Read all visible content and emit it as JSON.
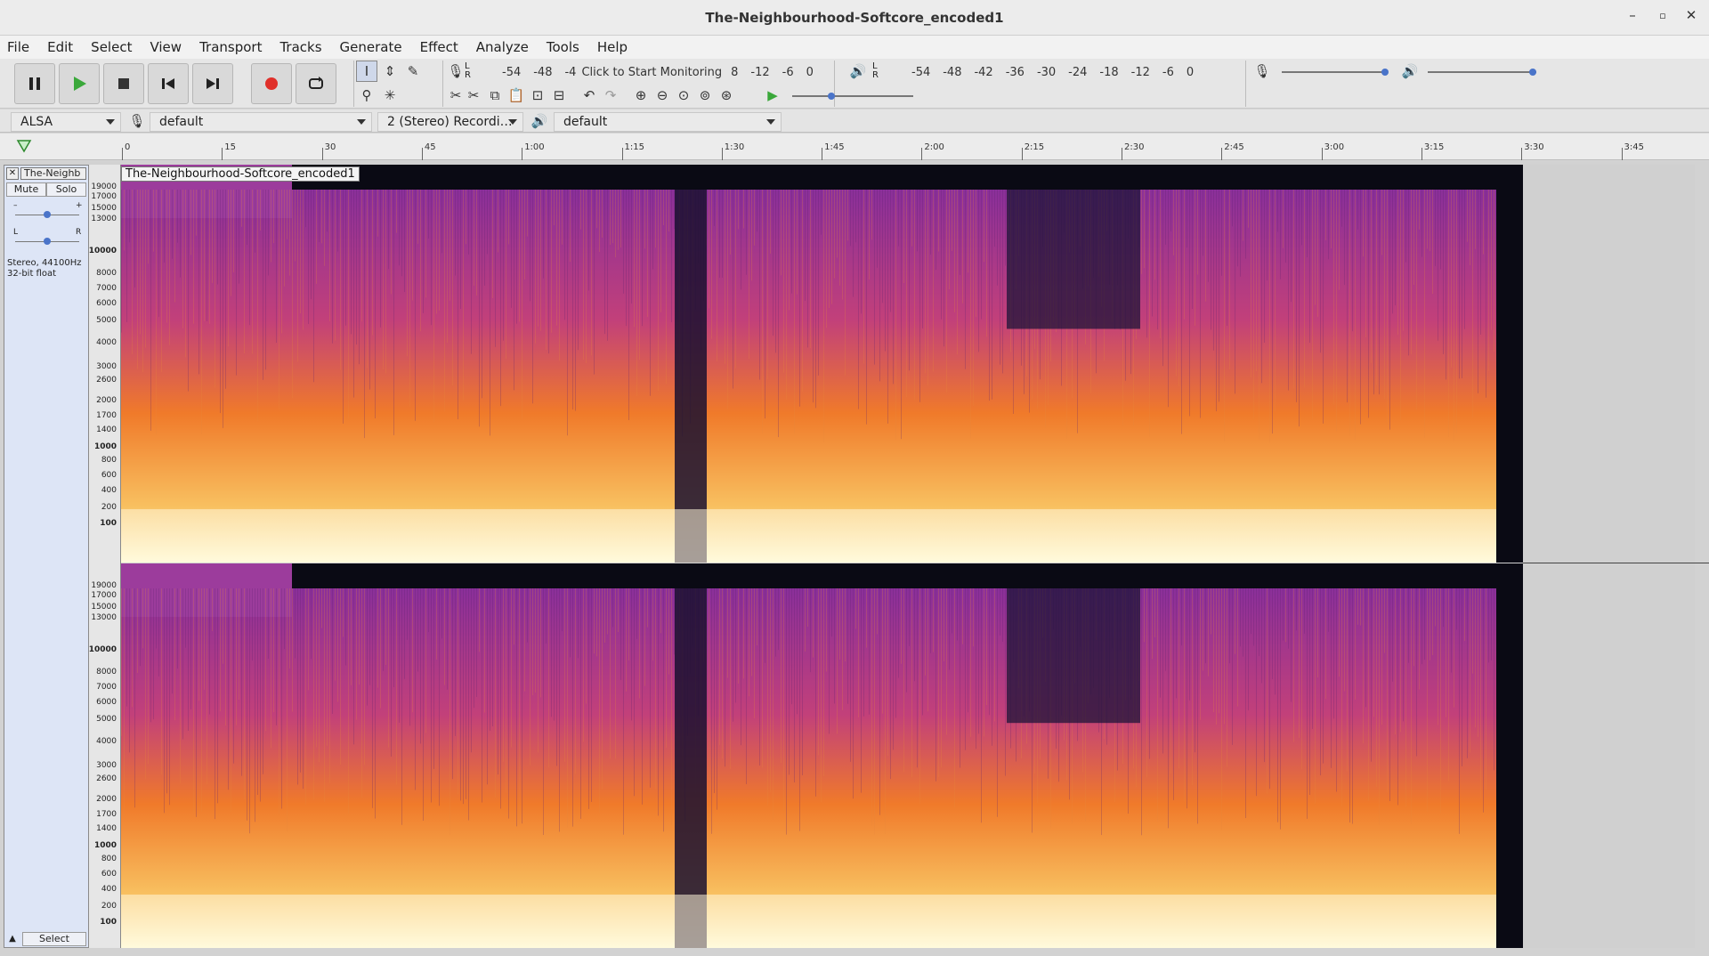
{
  "window": {
    "title": "The-Neighbourhood-Softcore_encoded1",
    "minimize": "–",
    "maximize": "▫",
    "close": "✕"
  },
  "menu": [
    "File",
    "Edit",
    "Select",
    "View",
    "Transport",
    "Tracks",
    "Generate",
    "Effect",
    "Analyze",
    "Tools",
    "Help"
  ],
  "record_meter": {
    "channels": "L\nR",
    "ticks": [
      "-54",
      "-48",
      "-4"
    ],
    "label": "Click to Start Monitoring",
    "ticks2": [
      "8",
      "-12",
      "-6",
      "0"
    ]
  },
  "playback_meter": {
    "channels": "L\nR",
    "ticks": [
      "-54",
      "-48",
      "-42",
      "-36",
      "-30",
      "-24",
      "-18",
      "-12",
      "-6",
      "0"
    ]
  },
  "device_bar": {
    "host": "ALSA",
    "recording_device": "default",
    "channels": "2 (Stereo) Recordi…",
    "playback_device": "default"
  },
  "ruler_ticks": [
    "0",
    "15",
    "30",
    "45",
    "1:00",
    "1:15",
    "1:30",
    "1:45",
    "2:00",
    "2:15",
    "2:30",
    "2:45",
    "3:00",
    "3:15",
    "3:30",
    "3:45"
  ],
  "track": {
    "name_short": "The-Neighb",
    "name": "The-Neighbourhood-Softcore_encoded1",
    "mute": "Mute",
    "solo": "Solo",
    "gain_minus": "–",
    "gain_plus": "+",
    "pan_left": "L",
    "pan_right": "R",
    "info_line1": "Stereo, 44100Hz",
    "info_line2": "32-bit float",
    "select": "Select"
  },
  "freq_labels": [
    "19000",
    "17000",
    "15000",
    "13000",
    "10000",
    "8000",
    "7000",
    "6000",
    "5000",
    "4000",
    "3000",
    "2600",
    "2000",
    "1700",
    "1400",
    "1000",
    "800",
    "600",
    "400",
    "200",
    "100"
  ],
  "colors": {
    "spectrogram_low": "#ffffe0",
    "spectrogram_mid": "#f07a2a",
    "spectrogram_high": "#8a2f9a",
    "spectrogram_silence": "#0a0a14",
    "record": "#e0302a",
    "play": "#3aa83a"
  }
}
